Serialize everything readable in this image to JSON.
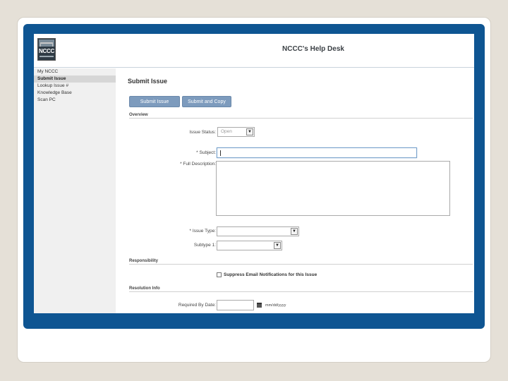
{
  "app": {
    "title": "NCCC's Help Desk",
    "logo_text": "NCCC"
  },
  "sidebar": {
    "items": [
      {
        "label": "My NCCC",
        "active": false
      },
      {
        "label": "Submit Issue",
        "active": true
      },
      {
        "label": "Lookup Issue #",
        "active": false
      },
      {
        "label": "Knowledge Base",
        "active": false
      },
      {
        "label": "Scan PC",
        "active": false
      }
    ]
  },
  "main": {
    "page_title": "Submit Issue",
    "buttons": {
      "submit": "Submit Issue",
      "submit_copy": "Submit and Copy"
    },
    "sections": {
      "overview": "Overview",
      "responsibility": "Responsibility",
      "resolution": "Resolution Info"
    },
    "fields": {
      "issue_status": {
        "label": "Issue Status:",
        "value": "Open"
      },
      "subject": {
        "label": "* Subject:",
        "value": ""
      },
      "full_description": {
        "label": "* Full Description:",
        "value": ""
      },
      "issue_type": {
        "label": "* Issue Type:",
        "value": ""
      },
      "subtype": {
        "label": "Subtype 1:",
        "value": ""
      },
      "suppress_email": {
        "label": "Suppress Email Notifications for this Issue",
        "checked": false
      },
      "required_by_date": {
        "label": "Required By Date:",
        "value": "",
        "format_hint": "mm/dd/yyyy"
      }
    }
  },
  "colors": {
    "frame": "#0e5592",
    "button": "#7d9bbd",
    "background": "#e5e0d7"
  },
  "icons": {
    "calendar": "calendar-icon",
    "dropdown": "chevron-down-icon"
  }
}
